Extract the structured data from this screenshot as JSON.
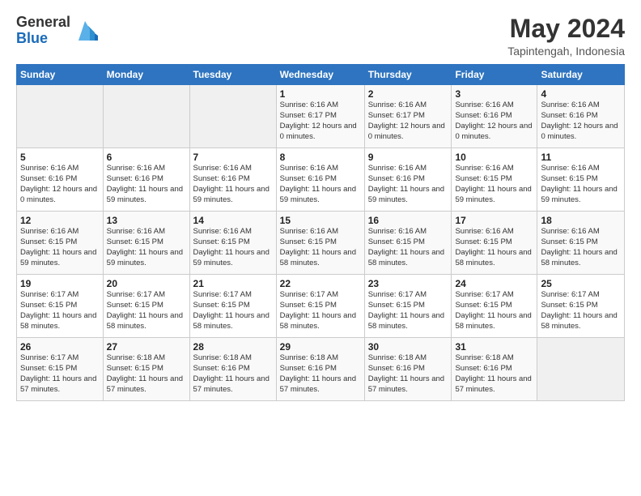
{
  "logo": {
    "line1": "General",
    "line2": "Blue"
  },
  "header": {
    "title": "May 2024",
    "location": "Tapintengah, Indonesia"
  },
  "weekdays": [
    "Sunday",
    "Monday",
    "Tuesday",
    "Wednesday",
    "Thursday",
    "Friday",
    "Saturday"
  ],
  "weeks": [
    [
      {
        "day": "",
        "sunrise": "",
        "sunset": "",
        "daylight": "",
        "empty": true
      },
      {
        "day": "",
        "sunrise": "",
        "sunset": "",
        "daylight": "",
        "empty": true
      },
      {
        "day": "",
        "sunrise": "",
        "sunset": "",
        "daylight": "",
        "empty": true
      },
      {
        "day": "1",
        "sunrise": "Sunrise: 6:16 AM",
        "sunset": "Sunset: 6:17 PM",
        "daylight": "Daylight: 12 hours and 0 minutes."
      },
      {
        "day": "2",
        "sunrise": "Sunrise: 6:16 AM",
        "sunset": "Sunset: 6:17 PM",
        "daylight": "Daylight: 12 hours and 0 minutes."
      },
      {
        "day": "3",
        "sunrise": "Sunrise: 6:16 AM",
        "sunset": "Sunset: 6:16 PM",
        "daylight": "Daylight: 12 hours and 0 minutes."
      },
      {
        "day": "4",
        "sunrise": "Sunrise: 6:16 AM",
        "sunset": "Sunset: 6:16 PM",
        "daylight": "Daylight: 12 hours and 0 minutes."
      }
    ],
    [
      {
        "day": "5",
        "sunrise": "Sunrise: 6:16 AM",
        "sunset": "Sunset: 6:16 PM",
        "daylight": "Daylight: 12 hours and 0 minutes."
      },
      {
        "day": "6",
        "sunrise": "Sunrise: 6:16 AM",
        "sunset": "Sunset: 6:16 PM",
        "daylight": "Daylight: 11 hours and 59 minutes."
      },
      {
        "day": "7",
        "sunrise": "Sunrise: 6:16 AM",
        "sunset": "Sunset: 6:16 PM",
        "daylight": "Daylight: 11 hours and 59 minutes."
      },
      {
        "day": "8",
        "sunrise": "Sunrise: 6:16 AM",
        "sunset": "Sunset: 6:16 PM",
        "daylight": "Daylight: 11 hours and 59 minutes."
      },
      {
        "day": "9",
        "sunrise": "Sunrise: 6:16 AM",
        "sunset": "Sunset: 6:16 PM",
        "daylight": "Daylight: 11 hours and 59 minutes."
      },
      {
        "day": "10",
        "sunrise": "Sunrise: 6:16 AM",
        "sunset": "Sunset: 6:15 PM",
        "daylight": "Daylight: 11 hours and 59 minutes."
      },
      {
        "day": "11",
        "sunrise": "Sunrise: 6:16 AM",
        "sunset": "Sunset: 6:15 PM",
        "daylight": "Daylight: 11 hours and 59 minutes."
      }
    ],
    [
      {
        "day": "12",
        "sunrise": "Sunrise: 6:16 AM",
        "sunset": "Sunset: 6:15 PM",
        "daylight": "Daylight: 11 hours and 59 minutes."
      },
      {
        "day": "13",
        "sunrise": "Sunrise: 6:16 AM",
        "sunset": "Sunset: 6:15 PM",
        "daylight": "Daylight: 11 hours and 59 minutes."
      },
      {
        "day": "14",
        "sunrise": "Sunrise: 6:16 AM",
        "sunset": "Sunset: 6:15 PM",
        "daylight": "Daylight: 11 hours and 59 minutes."
      },
      {
        "day": "15",
        "sunrise": "Sunrise: 6:16 AM",
        "sunset": "Sunset: 6:15 PM",
        "daylight": "Daylight: 11 hours and 58 minutes."
      },
      {
        "day": "16",
        "sunrise": "Sunrise: 6:16 AM",
        "sunset": "Sunset: 6:15 PM",
        "daylight": "Daylight: 11 hours and 58 minutes."
      },
      {
        "day": "17",
        "sunrise": "Sunrise: 6:16 AM",
        "sunset": "Sunset: 6:15 PM",
        "daylight": "Daylight: 11 hours and 58 minutes."
      },
      {
        "day": "18",
        "sunrise": "Sunrise: 6:16 AM",
        "sunset": "Sunset: 6:15 PM",
        "daylight": "Daylight: 11 hours and 58 minutes."
      }
    ],
    [
      {
        "day": "19",
        "sunrise": "Sunrise: 6:17 AM",
        "sunset": "Sunset: 6:15 PM",
        "daylight": "Daylight: 11 hours and 58 minutes."
      },
      {
        "day": "20",
        "sunrise": "Sunrise: 6:17 AM",
        "sunset": "Sunset: 6:15 PM",
        "daylight": "Daylight: 11 hours and 58 minutes."
      },
      {
        "day": "21",
        "sunrise": "Sunrise: 6:17 AM",
        "sunset": "Sunset: 6:15 PM",
        "daylight": "Daylight: 11 hours and 58 minutes."
      },
      {
        "day": "22",
        "sunrise": "Sunrise: 6:17 AM",
        "sunset": "Sunset: 6:15 PM",
        "daylight": "Daylight: 11 hours and 58 minutes."
      },
      {
        "day": "23",
        "sunrise": "Sunrise: 6:17 AM",
        "sunset": "Sunset: 6:15 PM",
        "daylight": "Daylight: 11 hours and 58 minutes."
      },
      {
        "day": "24",
        "sunrise": "Sunrise: 6:17 AM",
        "sunset": "Sunset: 6:15 PM",
        "daylight": "Daylight: 11 hours and 58 minutes."
      },
      {
        "day": "25",
        "sunrise": "Sunrise: 6:17 AM",
        "sunset": "Sunset: 6:15 PM",
        "daylight": "Daylight: 11 hours and 58 minutes."
      }
    ],
    [
      {
        "day": "26",
        "sunrise": "Sunrise: 6:17 AM",
        "sunset": "Sunset: 6:15 PM",
        "daylight": "Daylight: 11 hours and 57 minutes."
      },
      {
        "day": "27",
        "sunrise": "Sunrise: 6:18 AM",
        "sunset": "Sunset: 6:15 PM",
        "daylight": "Daylight: 11 hours and 57 minutes."
      },
      {
        "day": "28",
        "sunrise": "Sunrise: 6:18 AM",
        "sunset": "Sunset: 6:16 PM",
        "daylight": "Daylight: 11 hours and 57 minutes."
      },
      {
        "day": "29",
        "sunrise": "Sunrise: 6:18 AM",
        "sunset": "Sunset: 6:16 PM",
        "daylight": "Daylight: 11 hours and 57 minutes."
      },
      {
        "day": "30",
        "sunrise": "Sunrise: 6:18 AM",
        "sunset": "Sunset: 6:16 PM",
        "daylight": "Daylight: 11 hours and 57 minutes."
      },
      {
        "day": "31",
        "sunrise": "Sunrise: 6:18 AM",
        "sunset": "Sunset: 6:16 PM",
        "daylight": "Daylight: 11 hours and 57 minutes."
      },
      {
        "day": "",
        "sunrise": "",
        "sunset": "",
        "daylight": "",
        "empty": true
      }
    ]
  ]
}
